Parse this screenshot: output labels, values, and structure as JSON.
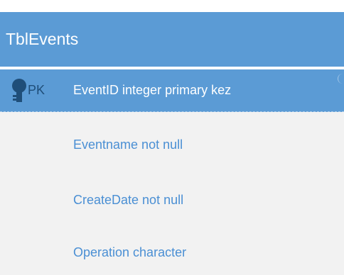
{
  "table": {
    "name": "TblEvents",
    "primary_key": {
      "badge": "PK",
      "label": "EventID integer primary kez"
    },
    "fields": [
      "Eventname not null",
      "CreateDate not null",
      "Operation character"
    ]
  },
  "colors": {
    "header": "#5b9bd5",
    "body": "#f2f2f2",
    "field_text": "#4a8fd4",
    "pk_badge": "#1f4e79"
  },
  "icons": {
    "pk": "key-icon"
  }
}
